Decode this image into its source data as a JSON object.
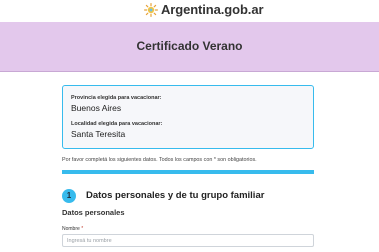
{
  "header": {
    "logo_text": "Argentina.gob.ar",
    "logo_icon": "sun-icon"
  },
  "banner": {
    "title": "Certificado Verano"
  },
  "summary": {
    "province_label": "Provincia elegida para vacacionar:",
    "province_value": "Buenos Aires",
    "locality_label": "Localidad elegida para vacacionar:",
    "locality_value": "Santa Teresita"
  },
  "form": {
    "note": "Por favor completá los siguientes datos. Todos los campos con * son obligatorios.",
    "step_number": "1",
    "step_title": "Datos personales y de tu grupo familiar",
    "section_title": "Datos personales",
    "name_label": "Nombre",
    "name_required_mark": "*",
    "name_placeholder": "Ingresá tu nombre"
  },
  "colors": {
    "banner_bg": "#e3c8ec",
    "accent": "#37bbed",
    "summary_bg": "#f6f7fa"
  }
}
